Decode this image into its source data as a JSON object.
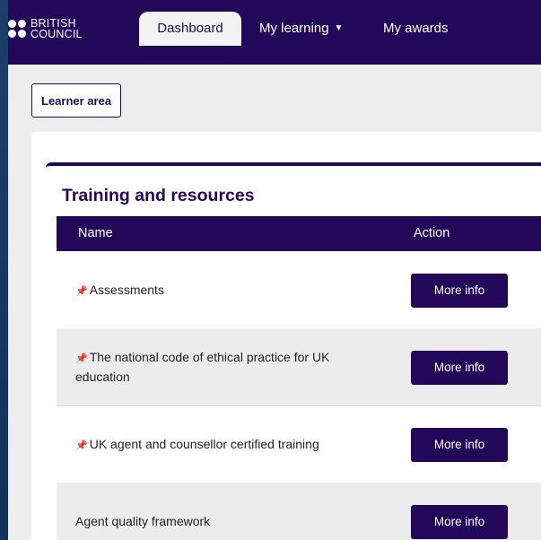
{
  "brand": {
    "line1": "BRITISH",
    "line2": "COUNCIL"
  },
  "nav": {
    "dashboard": "Dashboard",
    "my_learning": "My learning",
    "my_awards": "My awards"
  },
  "learner_area_label": "Learner area",
  "card": {
    "title": "Training and resources",
    "columns": {
      "name": "Name",
      "action": "Action"
    },
    "rows": [
      {
        "label": "Assessments",
        "pinned": true,
        "action": "More info"
      },
      {
        "label": "The national code of ethical practice for UK education",
        "pinned": true,
        "action": "More info"
      },
      {
        "label": "UK agent and counsellor certified training",
        "pinned": true,
        "action": "More info"
      },
      {
        "label": "Agent quality framework",
        "pinned": false,
        "action": "More info"
      }
    ]
  },
  "colors": {
    "brand_primary": "#23085a",
    "page_bg": "#ededed",
    "row_alt": "#ececec"
  },
  "icons": {
    "pin": "pushpin-icon",
    "caret": "caret-down-icon"
  }
}
